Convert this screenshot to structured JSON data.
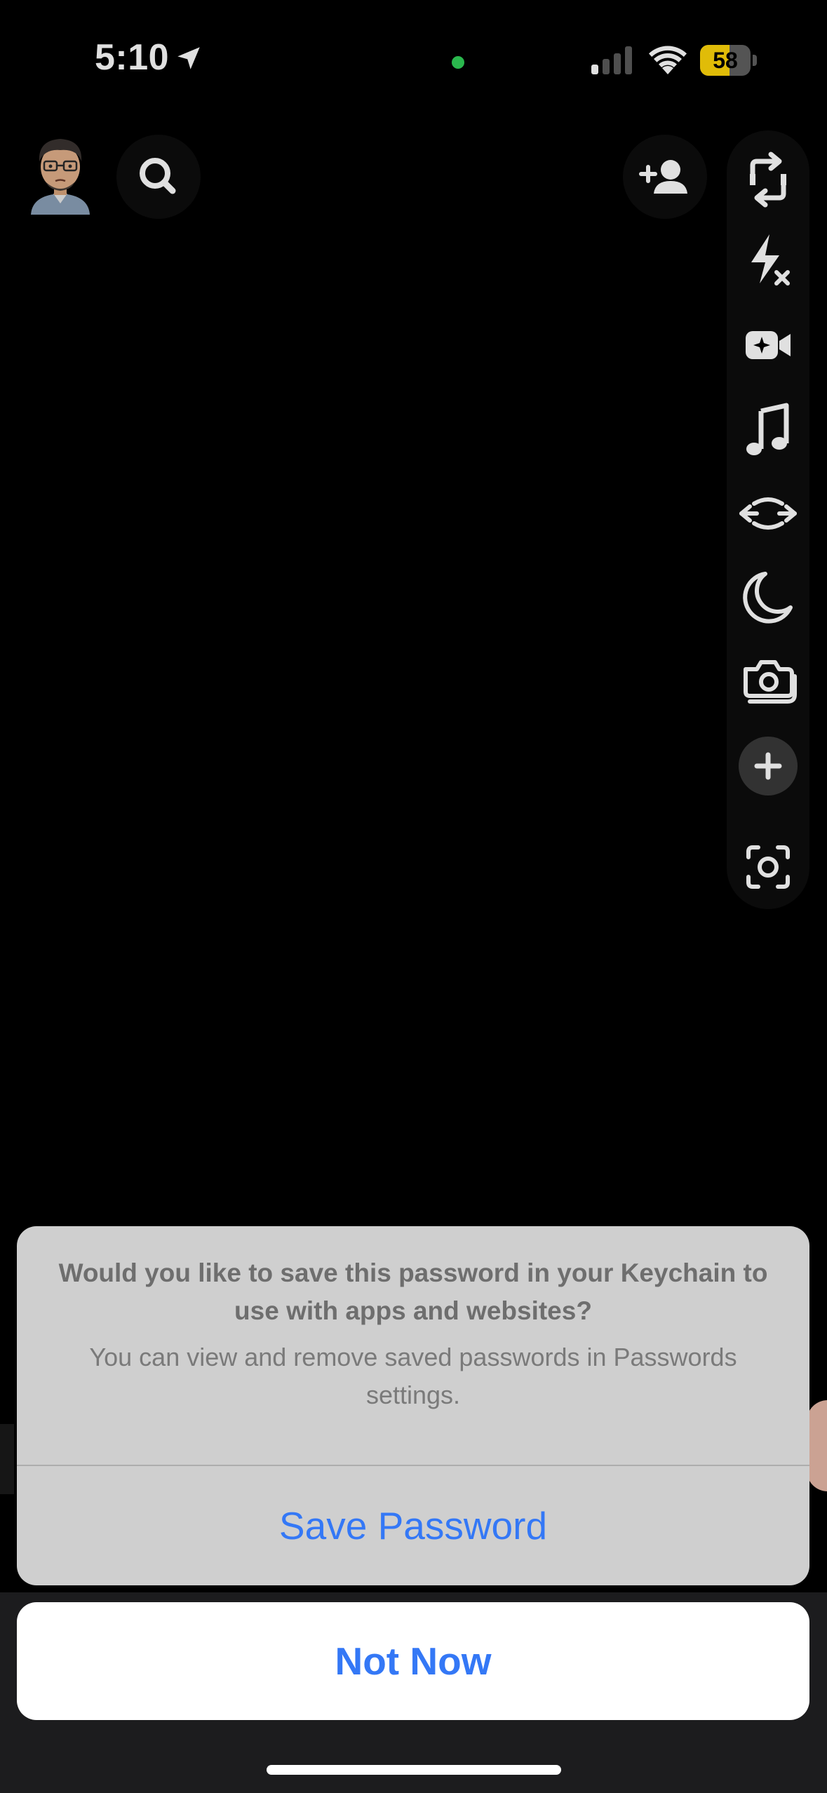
{
  "status_bar": {
    "time": "5:10",
    "battery_level": "58",
    "battery_fraction": 0.58,
    "location_icon": "location-arrow-icon",
    "camera_in_use_color": "#30d158",
    "battery_color": "#ffd60a"
  },
  "camera": {
    "top_left": [
      "profile-avatar",
      "search-icon"
    ],
    "top_right": [
      "add-friend-icon"
    ],
    "toolbar_icons": [
      "flip-camera-icon",
      "flash-off-icon",
      "video-effects-icon",
      "music-note-icon",
      "loop-arrows-icon",
      "night-mode-moon-icon",
      "multi-capture-camera-icon",
      "plus-icon",
      "scan-icon"
    ]
  },
  "keychain_prompt": {
    "title": "Would you like to save this password in your Keychain to use with apps and websites?",
    "message": "You can view and remove saved passwords in Passwords settings.",
    "primary_action": "Save Password",
    "cancel_action": "Not Now",
    "action_color": "#3478f6"
  }
}
